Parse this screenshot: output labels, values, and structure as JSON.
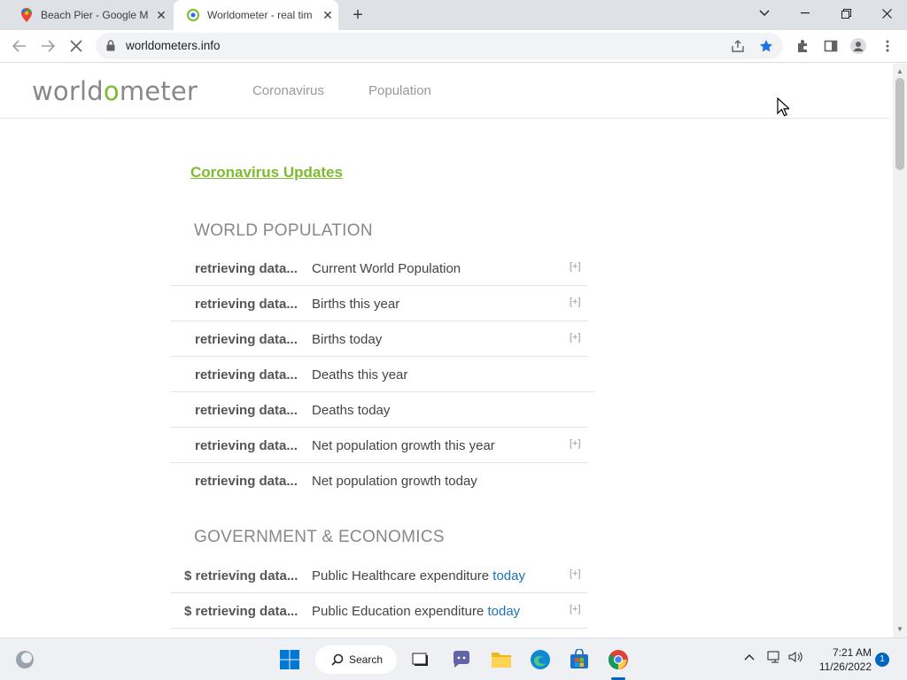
{
  "browser": {
    "tabs": [
      {
        "title": "Beach Pier - Google Ma",
        "active": false,
        "favicon": "google-maps-icon"
      },
      {
        "title": "Worldometer - real tim",
        "active": true,
        "favicon": "worldometer-icon"
      }
    ],
    "new_tab": "+",
    "address": "worldometers.info"
  },
  "site": {
    "logo_parts": [
      "world",
      "o",
      "meter"
    ],
    "nav": [
      "Coronavirus",
      "Population"
    ],
    "covid_link": "Coronavirus Updates"
  },
  "sections": [
    {
      "title": "WORLD POPULATION",
      "rows": [
        {
          "value": "retrieving data...",
          "label": "Current World Population",
          "expand": "[+]"
        },
        {
          "value": "retrieving data...",
          "label": "Births this year",
          "expand": "[+]"
        },
        {
          "value": "retrieving data...",
          "label": "Births today",
          "expand": "[+]"
        },
        {
          "value": "retrieving data...",
          "label": "Deaths this year",
          "expand": ""
        },
        {
          "value": "retrieving data...",
          "label": "Deaths today",
          "expand": ""
        },
        {
          "value": "retrieving data...",
          "label": "Net population growth this year",
          "expand": "[+]"
        },
        {
          "value": "retrieving data...",
          "label": "Net population growth today",
          "expand": ""
        }
      ]
    },
    {
      "title": "GOVERNMENT & ECONOMICS",
      "rows": [
        {
          "value": "$ retrieving data...",
          "label": "Public Healthcare expenditure",
          "highlight": "today",
          "expand": "[+]"
        },
        {
          "value": "$ retrieving data...",
          "label": "Public Education expenditure",
          "highlight": "today",
          "expand": "[+]"
        }
      ]
    }
  ],
  "taskbar": {
    "search_label": "Search",
    "time": "7:21 AM",
    "date": "11/26/2022",
    "notifications": "1"
  },
  "colors": {
    "brand_green": "#7cbb2e",
    "link_blue": "#1a73b8",
    "bookmark_star": "#1a73e8"
  }
}
